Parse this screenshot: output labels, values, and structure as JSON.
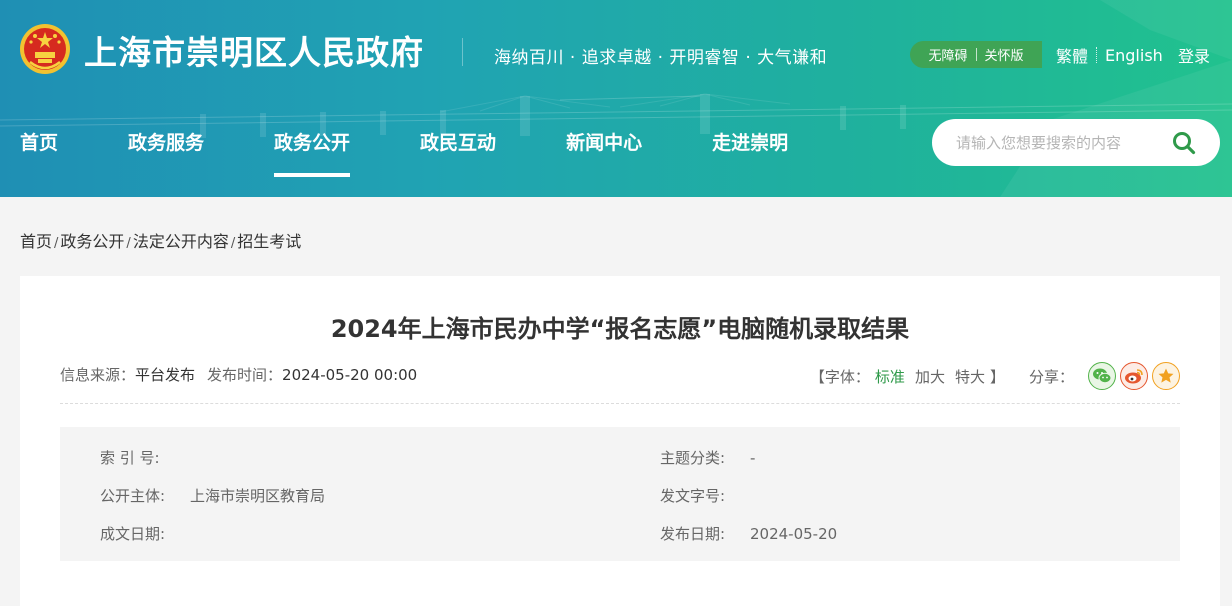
{
  "header": {
    "site_title": "上海市崇明区人民政府",
    "slogan": "海纳百川 · 追求卓越 · 开明睿智 · 大气谦和",
    "accessibility": "无障碍",
    "care_mode": "关怀版",
    "traditional": "繁體",
    "english": "English",
    "login": "登录",
    "nav": [
      "首页",
      "政务服务",
      "政务公开",
      "政民互动",
      "新闻中心",
      "走进崇明"
    ],
    "active_nav": "政务公开",
    "search_placeholder": "请输入您想要搜索的内容"
  },
  "breadcrumb": [
    "首页",
    "政务公开",
    "法定公开内容",
    "招生考试"
  ],
  "article": {
    "title": "2024年上海市民办中学“报名志愿”电脑随机录取结果",
    "source_label": "信息来源：",
    "source": "平台发布",
    "time_label": "发布时间：",
    "time": "2024-05-20 00:00",
    "font_open": "【字体：",
    "font_standard": "标准",
    "font_large": "加大",
    "font_xlarge": "特大",
    "font_close": "】",
    "share_label": "分享：",
    "share_icons": [
      "wechat-icon",
      "weibo-icon",
      "favorite-star-icon"
    ]
  },
  "info": {
    "index_label": "索 引 号:",
    "index_value": "",
    "topic_label": "主题分类:",
    "topic_value": "-",
    "publisher_label": "公开主体:",
    "publisher_value": "上海市崇明区教育局",
    "docno_label": "发文字号:",
    "docno_value": "",
    "written_label": "成文日期:",
    "written_value": "",
    "pubdate_label": "发布日期:",
    "pubdate_value": "2024-05-20"
  },
  "colors": {
    "header_gradient_start": "#1f8fb4",
    "header_gradient_end": "#21c28e",
    "accent_green": "#2f9a4a",
    "access_pill": "#3fa455"
  }
}
